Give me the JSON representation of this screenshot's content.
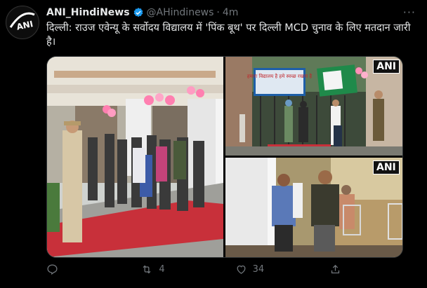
{
  "tweet": {
    "name": "ANI_HindiNews",
    "handle": "@AHindinews",
    "separator": "·",
    "time": "4m",
    "text": "दिल्ली: राउज एवेन्यू के सर्वोदय विद्यालय में 'पिंक बूथ' पर दिल्ली MCD चुनाव के लिए मतदान जारी है।",
    "more": "···"
  },
  "media": {
    "photo2_sign_text": "हमारा विद्यालय है हमे स्वच्छ रखना है",
    "badge": "ANI"
  },
  "actions": {
    "replies": "",
    "retweets": "4",
    "likes": "34",
    "share": ""
  },
  "colors": {
    "background": "#000000",
    "text": "#e7e9ea",
    "muted": "#71767b",
    "verified": "#1d9bf0",
    "pink_carpet": "#c8303a"
  }
}
